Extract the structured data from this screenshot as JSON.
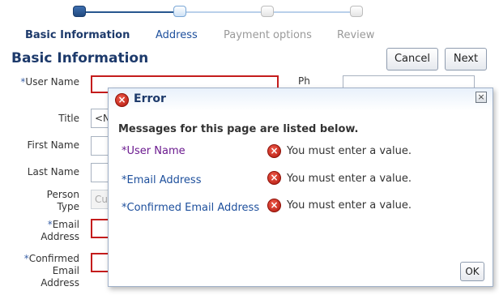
{
  "train": {
    "steps": [
      {
        "label": "Basic Information",
        "state": "current"
      },
      {
        "label": "Address",
        "state": "next"
      },
      {
        "label": "Payment options",
        "state": "disabled"
      },
      {
        "label": "Review",
        "state": "disabled"
      }
    ]
  },
  "header": {
    "title": "Basic Information",
    "cancel_label": "Cancel",
    "next_label": "Next"
  },
  "form": {
    "required_marker": "*",
    "user_name_label": "User Name",
    "title_label": "Title",
    "title_value": "<N",
    "first_name_label": "First Name",
    "last_name_label": "Last Name",
    "person_type_label": "Person Type",
    "person_type_value": "Cu",
    "email_label": "Email Address",
    "confirmed_email_label": "Confirmed Email Address",
    "phone_label_partial": "Ph"
  },
  "dialog": {
    "title": "Error",
    "heading": "Messages for this page are listed below.",
    "messages": [
      {
        "field": "User Name",
        "text": "You must enter a value."
      },
      {
        "field": "Email Address",
        "text": "You must enter a value."
      },
      {
        "field": "Confirmed Email Address",
        "text": "You must enter a value."
      }
    ],
    "ok_label": "OK"
  },
  "colors": {
    "title": "#1d3a6b",
    "error_red": "#c41c1c",
    "link_blue": "#1d4f9c",
    "visited_purple": "#6b1a8f"
  },
  "icons": {
    "error": "error-x-circle-icon",
    "close": "close-x-icon"
  }
}
